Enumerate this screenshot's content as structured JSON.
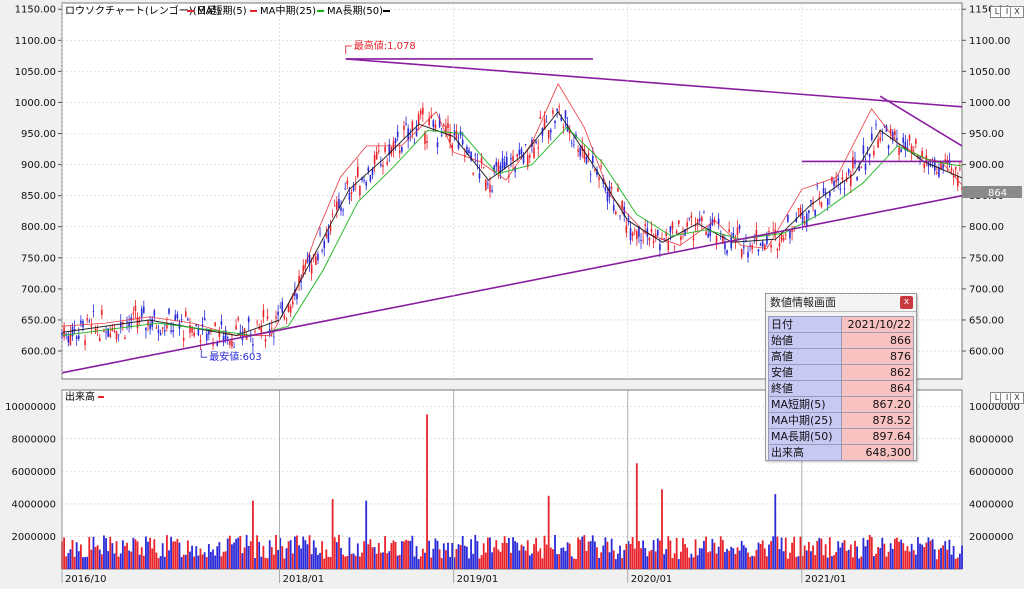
{
  "price_legend": {
    "title": "ロウソクチャート(レンゴー)(日足)",
    "items": [
      {
        "label": "MA短期(5)",
        "color": "#e8232a"
      },
      {
        "label": "MA中期(25)",
        "color": "#e8232a"
      },
      {
        "label": "MA長期(50)",
        "color": "#18b418"
      }
    ]
  },
  "volume_legend": {
    "label": "出来高"
  },
  "latest_price_tag": "864",
  "annotations": {
    "high_label": "最高値:1,078",
    "low_label": "最安値:603"
  },
  "window_controls": [
    "L",
    "I",
    "X"
  ],
  "info_panel": {
    "title": "数値情報画面",
    "close": "x",
    "rows": [
      {
        "key": "日付",
        "value": "2021/10/22"
      },
      {
        "key": "始値",
        "value": "866"
      },
      {
        "key": "高値",
        "value": "876"
      },
      {
        "key": "安値",
        "value": "862"
      },
      {
        "key": "終値",
        "value": "864"
      },
      {
        "key": "MA短期(5)",
        "value": "867.20"
      },
      {
        "key": "MA中期(25)",
        "value": "878.52"
      },
      {
        "key": "MA長期(50)",
        "value": "897.64"
      },
      {
        "key": "出来高",
        "value": "648,300"
      }
    ]
  },
  "chart_data": [
    {
      "type": "line",
      "panel": "price",
      "y_ticks": [
        "1150.00",
        "1100.00",
        "1050.00",
        "1000.00",
        "950.00",
        "900.00",
        "850.00",
        "800.00",
        "750.00",
        "700.00",
        "650.00",
        "600.00"
      ],
      "ylim": [
        555,
        1160
      ],
      "x_ticks": [
        "2016/10",
        "2018/01",
        "2019/01",
        "2020/01",
        "2021/01"
      ],
      "x_range": [
        2016.75,
        2021.92
      ],
      "series": [
        {
          "name": "MA短期(5)",
          "points": [
            [
              2016.75,
              640
            ],
            [
              2017.0,
              645
            ],
            [
              2017.25,
              655
            ],
            [
              2017.5,
              645
            ],
            [
              2017.75,
              625
            ],
            [
              2017.95,
              625
            ],
            [
              2018.1,
              700
            ],
            [
              2018.2,
              780
            ],
            [
              2018.35,
              880
            ],
            [
              2018.5,
              930
            ],
            [
              2018.7,
              930
            ],
            [
              2018.9,
              985
            ],
            [
              2019.0,
              920
            ],
            [
              2019.15,
              905
            ],
            [
              2019.3,
              875
            ],
            [
              2019.45,
              935
            ],
            [
              2019.6,
              1030
            ],
            [
              2019.75,
              960
            ],
            [
              2019.9,
              850
            ],
            [
              2020.1,
              790
            ],
            [
              2020.3,
              770
            ],
            [
              2020.5,
              810
            ],
            [
              2020.65,
              770
            ],
            [
              2020.8,
              765
            ],
            [
              2021.0,
              860
            ],
            [
              2021.2,
              880
            ],
            [
              2021.4,
              990
            ],
            [
              2021.55,
              935
            ],
            [
              2021.7,
              910
            ],
            [
              2021.8,
              905
            ],
            [
              2021.92,
              867.2
            ]
          ]
        },
        {
          "name": "MA中期(25)",
          "points": [
            [
              2016.75,
              630
            ],
            [
              2017.25,
              650
            ],
            [
              2017.75,
              625
            ],
            [
              2018.0,
              650
            ],
            [
              2018.2,
              755
            ],
            [
              2018.4,
              860
            ],
            [
              2018.6,
              910
            ],
            [
              2018.8,
              965
            ],
            [
              2019.0,
              945
            ],
            [
              2019.2,
              875
            ],
            [
              2019.4,
              915
            ],
            [
              2019.6,
              985
            ],
            [
              2019.8,
              900
            ],
            [
              2020.0,
              810
            ],
            [
              2020.2,
              775
            ],
            [
              2020.4,
              805
            ],
            [
              2020.6,
              775
            ],
            [
              2020.85,
              780
            ],
            [
              2021.05,
              835
            ],
            [
              2021.3,
              885
            ],
            [
              2021.45,
              955
            ],
            [
              2021.7,
              905
            ],
            [
              2021.92,
              878.52
            ]
          ]
        },
        {
          "name": "MA長期(50)",
          "points": [
            [
              2016.75,
              625
            ],
            [
              2017.3,
              645
            ],
            [
              2017.85,
              625
            ],
            [
              2018.05,
              640
            ],
            [
              2018.25,
              730
            ],
            [
              2018.45,
              840
            ],
            [
              2018.65,
              895
            ],
            [
              2018.85,
              955
            ],
            [
              2019.05,
              950
            ],
            [
              2019.25,
              885
            ],
            [
              2019.45,
              900
            ],
            [
              2019.65,
              960
            ],
            [
              2019.85,
              905
            ],
            [
              2020.05,
              820
            ],
            [
              2020.25,
              785
            ],
            [
              2020.45,
              795
            ],
            [
              2020.65,
              780
            ],
            [
              2020.9,
              790
            ],
            [
              2021.1,
              820
            ],
            [
              2021.35,
              870
            ],
            [
              2021.55,
              930
            ],
            [
              2021.75,
              905
            ],
            [
              2021.92,
              897.64
            ]
          ]
        }
      ],
      "high": {
        "label": "最高値:1,078",
        "x": 2018.38,
        "y": 1078
      },
      "low": {
        "label": "最安値:603",
        "x": 2017.55,
        "y": 603
      },
      "trendlines": [
        {
          "from": [
            2016.75,
            565
          ],
          "to": [
            2021.92,
            850
          ]
        },
        {
          "from": [
            2018.38,
            1070
          ],
          "to": [
            2021.92,
            993
          ]
        },
        {
          "from": [
            2018.38,
            1070
          ],
          "to": [
            2019.8,
            1070
          ]
        },
        {
          "from": [
            2021.0,
            905
          ],
          "to": [
            2021.92,
            905
          ]
        },
        {
          "from": [
            2021.45,
            1010
          ],
          "to": [
            2021.92,
            930
          ]
        }
      ]
    },
    {
      "type": "bar",
      "panel": "volume",
      "y_ticks": [
        "10000000",
        "8000000",
        "6000000",
        "4000000",
        "2000000"
      ],
      "ylim": [
        0,
        11000000
      ],
      "x_ticks": [
        "2016/10",
        "2018/01",
        "2019/01",
        "2020/01",
        "2021/01"
      ],
      "x_range": [
        2016.75,
        2021.92
      ],
      "spikes": [
        [
          2017.85,
          4200000
        ],
        [
          2018.3,
          4300000
        ],
        [
          2018.5,
          4200000
        ],
        [
          2018.85,
          9500000
        ],
        [
          2019.55,
          4500000
        ],
        [
          2020.05,
          6500000
        ],
        [
          2020.2,
          4900000
        ],
        [
          2020.85,
          4600000
        ]
      ]
    }
  ]
}
